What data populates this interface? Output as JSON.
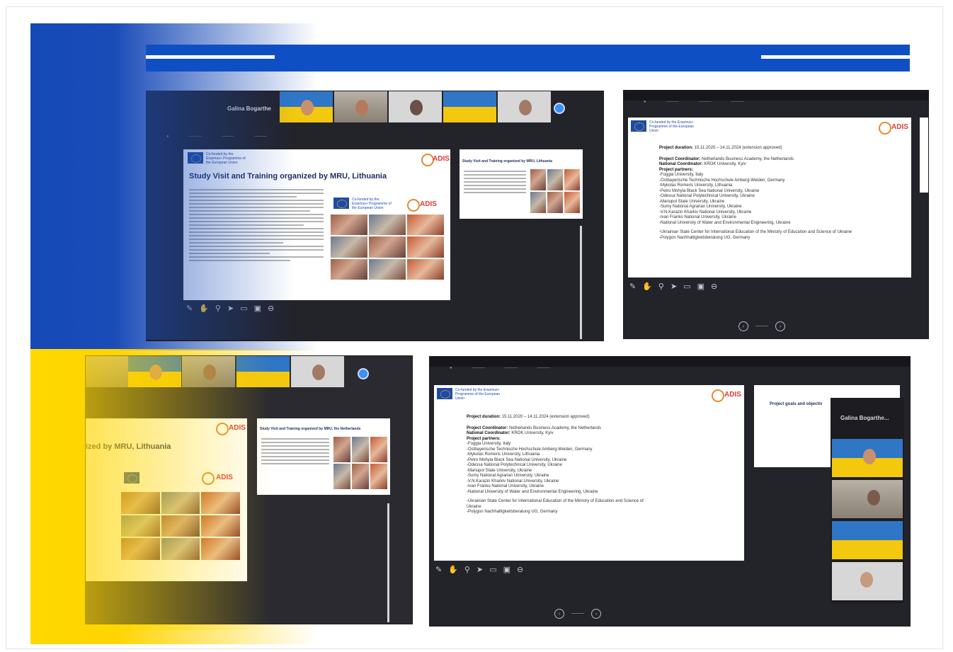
{
  "banner": {
    "accent_blue": "#0f4fc4",
    "accent_yellow": "#ffd800"
  },
  "screens": {
    "s1": {
      "presenter_name": "Galina Bogarthe",
      "slide_title": "Study Visit and Training organized by MRU, Lithuania",
      "eu_label": "Co-funded by the Erasmus+ Programme of the European Union",
      "logo_text": "ADIS",
      "side_title": "Study Visit and Training organized by MRU, Lithuania"
    },
    "s2": {
      "eu_label": "Co-funded by the Erasmus+ Programme of the European Union",
      "logo_text": "ADIS",
      "project_duration_label": "Project duration:",
      "project_duration_value": "15.11.2020 – 14.11.2024 (extension approved)",
      "coordinator_label": "Project Coordinator:",
      "coordinator_value": "Netherlands Business Academy, the Netherlands",
      "national_label": "National Coordinator:",
      "national_value": "KROK University, Kyiv",
      "partners_label": "Project partners:",
      "partners": [
        "-Foggia University, Italy",
        "-Ostbayerische Technische Hochschule Amberg-Weiden, Germany",
        "-Mykolas Romeris University, Lithuania",
        "-Petro Mohyla Black Sea National University, Ukraine",
        "-Odessa National Polytechnical University, Ukraine",
        "-Mariupol State University, Ukraine",
        "-Sumy National Agrarian University, Ukraine",
        "-V.N.Karazin Kharkiv National University, Ukraine",
        "-Ivan Franko National University, Ukraine",
        "-National University of Water and Environmental Engineering, Ukraine"
      ],
      "extra_lines": [
        "-Ukrainian State Center for International Education of the Ministry of Education and Science of Ukraine",
        "-Polygon Nachhaltigkeitsberatung UG, Germany"
      ]
    },
    "s3": {
      "slide_title": "ized by MRU, Lithuania",
      "logo_text": "ADIS",
      "side_title": "Study Visit and Training organized by MRU, the Netherlands"
    },
    "s4": {
      "eu_label": "Co-funded by the Erasmus+ Programme of the European Union",
      "logo_text": "ADIS",
      "side_title": "Project goals and objectiv",
      "presenter_name": "Galina Bogarthe...",
      "project_duration_label": "Project duration:",
      "project_duration_value": "15.11.2020 – 14.11.2024 (extension approved)",
      "coordinator_label": "Project Coordinator:",
      "coordinator_value": "Netherlands Business Academy, the Netherlands",
      "national_label": "National Coordinator:",
      "national_value": "KROK University, Kyiv",
      "partners_label": "Project partners:",
      "partners": [
        "-Foggia University, Italy",
        "-Ostbayerische Technische Hochschule Amberg-Weiden, Germany",
        "-Mykolas Romeris University, Lithuania",
        "-Petro Mohyla Black Sea National University, Ukraine",
        "-Odessa National Polytechnical University, Ukraine",
        "-Mariupol State University, Ukraine",
        "-Sumy National Agrarian University, Ukraine",
        "-V.N.Karazin Kharkiv National University, Ukraine",
        "-Ivan Franko National University, Ukraine",
        "-National University of Water and Environmental Engineering, Ukraine"
      ],
      "extra_lines": [
        "-Ukrainian State Center for International Education of the Ministry of Education and Science of",
        "Ukraine",
        "-Polygon Nachhaltigkeitsberatung UG, Germany"
      ]
    }
  }
}
